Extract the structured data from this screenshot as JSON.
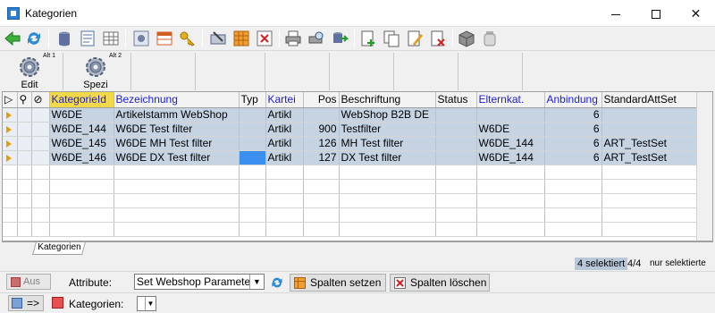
{
  "window": {
    "title": "Kategorien"
  },
  "toolbar": {
    "icons": [
      "back-icon",
      "refresh-icon",
      "database-icon",
      "form-view-icon",
      "grid-view-icon",
      "settings-icon",
      "table-icon",
      "key-icon",
      "tools-icon",
      "grid-orange-icon",
      "delete-grid-icon",
      "print-icon",
      "print-preview-icon",
      "export-icon",
      "new-record-icon",
      "copy-record-icon",
      "edit-record-icon",
      "delete-record-icon",
      "package-icon",
      "jar-icon"
    ]
  },
  "big_buttons": [
    {
      "label": "Edit",
      "shortcut": "Alt 1"
    },
    {
      "label": "Spezi",
      "shortcut": "Alt 2"
    }
  ],
  "grid": {
    "columns": [
      {
        "label": "KategorieId",
        "style": "hl"
      },
      {
        "label": "Bezeichnung",
        "style": "blue"
      },
      {
        "label": "Typ",
        "style": ""
      },
      {
        "label": "Kartei",
        "style": "blue"
      },
      {
        "label": "Pos",
        "style": ""
      },
      {
        "label": "Beschriftung",
        "style": ""
      },
      {
        "label": "Status",
        "style": ""
      },
      {
        "label": "Elternkat.",
        "style": "blue"
      },
      {
        "label": "Anbindung",
        "style": "blue"
      },
      {
        "label": "StandardAttSet",
        "style": ""
      }
    ],
    "rows": [
      {
        "KategorieId": "W6DE",
        "Bezeichnung": "Artikelstamm WebShop",
        "Typ": "",
        "Kartei": "Artikl",
        "Pos": "",
        "Beschriftung": "WebShop B2B DE",
        "Status": "",
        "Elternkat": "",
        "Anbindung": "6",
        "StandardAttSet": ""
      },
      {
        "KategorieId": "W6DE_144",
        "Bezeichnung": "W6DE Test filter",
        "Typ": "",
        "Kartei": "Artikl",
        "Pos": "900",
        "Beschriftung": "Testfilter",
        "Status": "",
        "Elternkat": "W6DE",
        "Anbindung": "6",
        "StandardAttSet": ""
      },
      {
        "KategorieId": "W6DE_145",
        "Bezeichnung": "W6DE MH Test filter",
        "Typ": "",
        "Kartei": "Artikl",
        "Pos": "126",
        "Beschriftung": "MH Test filter",
        "Status": "",
        "Elternkat": "W6DE_144",
        "Anbindung": "6",
        "StandardAttSet": "ART_TestSet"
      },
      {
        "KategorieId": "W6DE_146",
        "Bezeichnung": "W6DE DX Test filter",
        "Typ": "",
        "Kartei": "Artikl",
        "Pos": "127",
        "Beschriftung": "DX Test filter",
        "Status": "",
        "Elternkat": "W6DE_144",
        "Anbindung": "6",
        "StandardAttSet": "ART_TestSet"
      }
    ]
  },
  "tabs": [
    {
      "label": "Kategorien"
    }
  ],
  "status": {
    "selected": "4 selektiert",
    "count": "4/4",
    "only_selected": "nur selektierte"
  },
  "attributes": {
    "aus_label": "Aus",
    "label": "Attribute:",
    "select_value": "Set Webshop Parameter",
    "set_columns": "Spalten setzen",
    "delete_columns": "Spalten löschen"
  },
  "bottom": {
    "nav_label": "=>",
    "kategorien_label": "Kategorien:"
  },
  "colors": {
    "selection": "#c5d3e3",
    "header_highlight": "#f2d94a",
    "link_blue": "#2020d0"
  }
}
